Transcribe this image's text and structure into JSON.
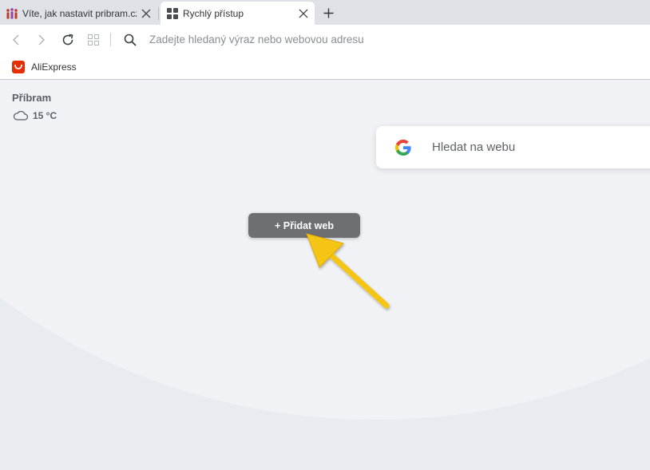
{
  "tabs": [
    {
      "title": "Víte, jak nastavit pribram.cz",
      "favicon": "people-favicon-icon",
      "active": false
    },
    {
      "title": "Rychlý přístup",
      "favicon": "speed-dial-grid-icon",
      "active": true
    }
  ],
  "toolbar": {
    "address_placeholder": "Zadejte hledaný výraz nebo webovou adresu"
  },
  "bookmarks": [
    {
      "label": "AliExpress",
      "icon": "aliexpress-icon"
    }
  ],
  "weather": {
    "city": "Příbram",
    "temperature": "15 °C",
    "icon": "cloud-icon"
  },
  "search": {
    "label": "Hledat na webu",
    "engine_icon": "google-icon"
  },
  "speed_dial": {
    "add_button_label": "+ Přidat web"
  },
  "colors": {
    "accent_arrow": "#f5c518",
    "aliexpress_red": "#e62e04",
    "add_button_bg": "#6d6f73"
  }
}
